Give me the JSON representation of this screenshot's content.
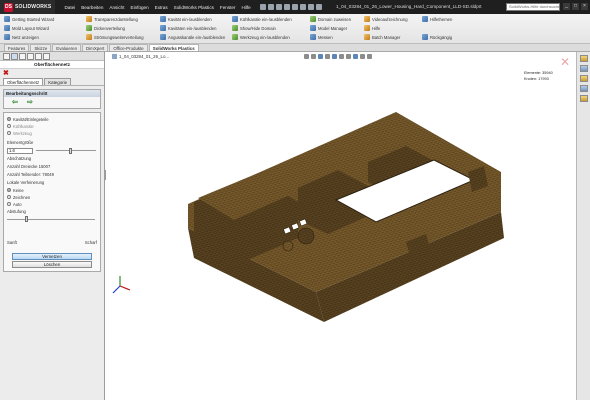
{
  "app": {
    "logo_letters": "DS",
    "logo_text": "SOLIDWORKS",
    "menu": [
      "Datei",
      "Bearbeiten",
      "Ansicht",
      "Einfügen",
      "Extras",
      "SolidWorks Plastics",
      "Fenster",
      "Hilfe"
    ],
    "document_title": "1_04_03284_01_26_Lower_Housing_Hard_Component_LLD-SD.sldprt",
    "search_placeholder": "SolidWorks-Hilfe durchsuchen",
    "window_controls": [
      "_",
      "□",
      "×"
    ]
  },
  "command_manager": {
    "row1": [
      "Getting Started Wizard",
      "Transparenzdarstellung",
      "Kavität ein-/ausblenden",
      "Kühlkanäle ein-/ausblenden",
      "Domain zuweisen",
      "Videoaufzeichnung",
      "Hilfethemen"
    ],
    "row2": [
      "Mold Layout Wizard",
      "Dickenverteilung",
      "Kavitäten ein-/ausblenden",
      "Show/Hide Domain",
      "Model Manager",
      "Hilfe"
    ],
    "row3": [
      "Netz anzeigen",
      "Strömungsweiterverteilung",
      "Angusskanäle ein-/ausblenden",
      "Werkzeug ein-/ausblenden",
      "Messen",
      "Batch Manager",
      "Rückgängig"
    ]
  },
  "tabs": [
    {
      "label": "Features",
      "active": false
    },
    {
      "label": "Skizze",
      "active": false
    },
    {
      "label": "Evaluieren",
      "active": false
    },
    {
      "label": "DimXpert",
      "active": false
    },
    {
      "label": "Office-Produkte",
      "active": false
    },
    {
      "label": "SolidWorks Plastics",
      "active": true
    }
  ],
  "panel": {
    "title": "Oberflächennetz",
    "close_symbol": "✖",
    "subtabs": [
      {
        "label": "Oberflächennetz",
        "active": true
      },
      {
        "label": "Kategorie",
        "active": false
      }
    ],
    "steps_header": "Bearbeitungsschritt",
    "back_arrow": "⇦",
    "forward_arrow": "⇨",
    "mesh_options": [
      {
        "label": "Kavität/Einlegeteile",
        "on": true
      },
      {
        "label": "Kühlkanäle",
        "on": false
      },
      {
        "label": "Werkzeug",
        "on": false
      }
    ],
    "element_size_label": "Elementgröße",
    "element_size_value": "1.6",
    "element_size_slider": 0.55,
    "sizing_label": "Abschätzung",
    "element_count": "Anzahl Dreiecke 15007",
    "part_count": "Anzahl Teilsender: 78049",
    "refine_label": "Lokale Verfeinerung",
    "refine_options": [
      {
        "label": "Keine",
        "on": true
      },
      {
        "label": "Zeichnen",
        "on": false
      },
      {
        "label": "Auto",
        "on": false
      }
    ],
    "smoothing_label": "Abstufung",
    "smoothing_slider": 0.2,
    "slider_low": "Sanft",
    "slider_high": "Scharf",
    "mesh_button": "Vernetzen",
    "delete_button": "Löschen"
  },
  "viewport": {
    "document_name": "1_04_03284_01_26_Lo...",
    "element_info_1": "Elemente: 35940",
    "element_info_2": "Knoten: 17993",
    "model_color": "#5b4420",
    "mesh_color": "#2c2010"
  },
  "colors": {
    "title_bar": "#1f1f1f",
    "brand_red": "#c8102e",
    "panel_bg": "#ececec",
    "accent_blue": "#b9d7f3"
  }
}
